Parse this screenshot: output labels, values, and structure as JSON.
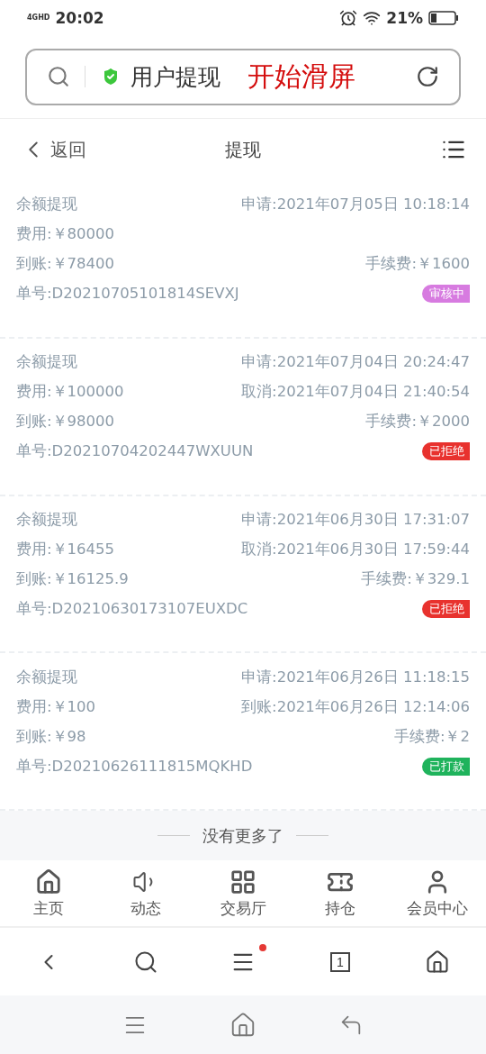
{
  "status_bar": {
    "network": "4GHD",
    "time": "20:02",
    "battery": "21%"
  },
  "address_bar": {
    "title": "用户提现",
    "slogan": "开始滑屏"
  },
  "header": {
    "back": "返回",
    "title": "提现"
  },
  "records": [
    {
      "type": "余额提现",
      "applied": "申请:2021年07月05日 10:18:14",
      "rows": [
        {
          "left": "费用:￥80000"
        },
        {
          "left": "到账:￥78400",
          "right": "手续费:￥1600"
        }
      ],
      "order": "单号:D20210705101814SEVXJ",
      "status": {
        "label": "审核中",
        "color": "#d77be0"
      }
    },
    {
      "type": "余额提现",
      "applied": "申请:2021年07月04日 20:24:47",
      "rows": [
        {
          "left": "费用:￥100000",
          "right": "取消:2021年07月04日 21:40:54"
        },
        {
          "left": "到账:￥98000",
          "right": "手续费:￥2000"
        }
      ],
      "order": "单号:D20210704202447WXUUN",
      "status": {
        "label": "已拒绝",
        "color": "#e8322e"
      }
    },
    {
      "type": "余额提现",
      "applied": "申请:2021年06月30日 17:31:07",
      "rows": [
        {
          "left": "费用:￥16455",
          "right": "取消:2021年06月30日 17:59:44"
        },
        {
          "left": "到账:￥16125.9",
          "right": "手续费:￥329.1"
        }
      ],
      "order": "单号:D20210630173107EUXDC",
      "status": {
        "label": "已拒绝",
        "color": "#e8322e"
      }
    },
    {
      "type": "余额提现",
      "applied": "申请:2021年06月26日 11:18:15",
      "rows": [
        {
          "left": "费用:￥100",
          "right": "到账:2021年06月26日 12:14:06"
        },
        {
          "left": "到账:￥98",
          "right": "手续费:￥2"
        }
      ],
      "order": "单号:D20210626111815MQKHD",
      "status": {
        "label": "已打款",
        "color": "#1fb35c"
      }
    }
  ],
  "end_note": "没有更多了",
  "tab_bar": [
    {
      "kind": "home",
      "label": "主页"
    },
    {
      "kind": "news",
      "label": "动态"
    },
    {
      "kind": "grid",
      "label": "交易厅"
    },
    {
      "kind": "ticket",
      "label": "持仓"
    },
    {
      "kind": "user",
      "label": "会员中心"
    }
  ],
  "browser_bar": [
    {
      "kind": "back"
    },
    {
      "kind": "search"
    },
    {
      "kind": "menu",
      "badge": true
    },
    {
      "kind": "tabs",
      "count": "1"
    },
    {
      "kind": "home"
    }
  ]
}
